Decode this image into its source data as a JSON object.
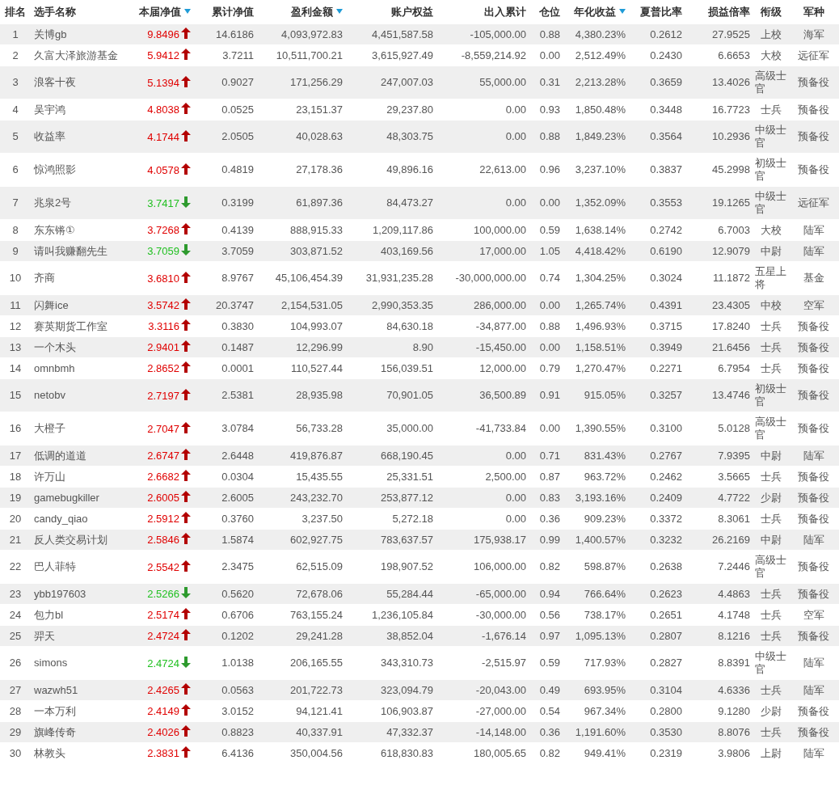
{
  "table": {
    "columns": [
      {
        "label": "排名",
        "sort_indicator": false
      },
      {
        "label": "选手名称",
        "sort_indicator": false
      },
      {
        "label": "本届净值",
        "sort_indicator": true
      },
      {
        "label": "累计净值",
        "sort_indicator": false
      },
      {
        "label": "盈利金额",
        "sort_indicator": true
      },
      {
        "label": "账户权益",
        "sort_indicator": false
      },
      {
        "label": "出入累计",
        "sort_indicator": false
      },
      {
        "label": "仓位",
        "sort_indicator": false
      },
      {
        "label": "年化收益",
        "sort_indicator": true
      },
      {
        "label": "夏普比率",
        "sort_indicator": false
      },
      {
        "label": "损益倍率",
        "sort_indicator": false
      },
      {
        "label": "衔级",
        "sort_indicator": false
      },
      {
        "label": "军种",
        "sort_indicator": false
      }
    ],
    "rows": [
      {
        "rising": true,
        "cells": [
          "1",
          "关博gb",
          "9.8496",
          "14.6186",
          "4,093,972.83",
          "4,451,587.58",
          "-105,000.00",
          "0.88",
          "4,380.23%",
          "0.2612",
          "27.9525",
          "上校",
          "海军"
        ]
      },
      {
        "rising": true,
        "cells": [
          "2",
          "久富大泽旅游基金",
          "5.9412",
          "3.7211",
          "10,511,700.21",
          "3,615,927.49",
          "-8,559,214.92",
          "0.00",
          "2,512.49%",
          "0.2430",
          "6.6653",
          "大校",
          "远征军"
        ]
      },
      {
        "rising": true,
        "cells": [
          "3",
          "浪客十夜",
          "5.1394",
          "0.9027",
          "171,256.29",
          "247,007.03",
          "55,000.00",
          "0.31",
          "2,213.28%",
          "0.3659",
          "13.4026",
          "高级士官",
          "预备役"
        ]
      },
      {
        "rising": true,
        "cells": [
          "4",
          "吴宇鸿",
          "4.8038",
          "0.0525",
          "23,151.37",
          "29,237.80",
          "0.00",
          "0.93",
          "1,850.48%",
          "0.3448",
          "16.7723",
          "士兵",
          "预备役"
        ]
      },
      {
        "rising": true,
        "cells": [
          "5",
          "收益率",
          "4.1744",
          "2.0505",
          "40,028.63",
          "48,303.75",
          "0.00",
          "0.88",
          "1,849.23%",
          "0.3564",
          "10.2936",
          "中级士官",
          "预备役"
        ]
      },
      {
        "rising": true,
        "cells": [
          "6",
          "惊鸿照影",
          "4.0578",
          "0.4819",
          "27,178.36",
          "49,896.16",
          "22,613.00",
          "0.96",
          "3,237.10%",
          "0.3837",
          "45.2998",
          "初级士官",
          "预备役"
        ]
      },
      {
        "rising": false,
        "cells": [
          "7",
          "兆泉2号",
          "3.7417",
          "0.3199",
          "61,897.36",
          "84,473.27",
          "0.00",
          "0.00",
          "1,352.09%",
          "0.3553",
          "19.1265",
          "中级士官",
          "远征军"
        ]
      },
      {
        "rising": true,
        "cells": [
          "8",
          "东东锵①",
          "3.7268",
          "0.4139",
          "888,915.33",
          "1,209,117.86",
          "100,000.00",
          "0.59",
          "1,638.14%",
          "0.2742",
          "6.7003",
          "大校",
          "陆军"
        ]
      },
      {
        "rising": false,
        "cells": [
          "9",
          "请叫我赚翻先生",
          "3.7059",
          "3.7059",
          "303,871.52",
          "403,169.56",
          "17,000.00",
          "1.05",
          "4,418.42%",
          "0.6190",
          "12.9079",
          "中尉",
          "陆军"
        ]
      },
      {
        "rising": true,
        "cells": [
          "10",
          "齐商",
          "3.6810",
          "8.9767",
          "45,106,454.39",
          "31,931,235.28",
          "-30,000,000.00",
          "0.74",
          "1,304.25%",
          "0.3024",
          "11.1872",
          "五星上将",
          "基金"
        ]
      },
      {
        "rising": true,
        "cells": [
          "11",
          "闪舞ice",
          "3.5742",
          "20.3747",
          "2,154,531.05",
          "2,990,353.35",
          "286,000.00",
          "0.00",
          "1,265.74%",
          "0.4391",
          "23.4305",
          "中校",
          "空军"
        ]
      },
      {
        "rising": true,
        "cells": [
          "12",
          "赛英期货工作室",
          "3.3116",
          "0.3830",
          "104,993.07",
          "84,630.18",
          "-34,877.00",
          "0.88",
          "1,496.93%",
          "0.3715",
          "17.8240",
          "士兵",
          "预备役"
        ]
      },
      {
        "rising": true,
        "cells": [
          "13",
          "一个木头",
          "2.9401",
          "0.1487",
          "12,296.99",
          "8.90",
          "-15,450.00",
          "0.00",
          "1,158.51%",
          "0.3949",
          "21.6456",
          "士兵",
          "预备役"
        ]
      },
      {
        "rising": true,
        "cells": [
          "14",
          "omnbmh",
          "2.8652",
          "0.0001",
          "110,527.44",
          "156,039.51",
          "12,000.00",
          "0.79",
          "1,270.47%",
          "0.2271",
          "6.7954",
          "士兵",
          "预备役"
        ]
      },
      {
        "rising": true,
        "cells": [
          "15",
          "netobv",
          "2.7197",
          "2.5381",
          "28,935.98",
          "70,901.05",
          "36,500.89",
          "0.91",
          "915.05%",
          "0.3257",
          "13.4746",
          "初级士官",
          "预备役"
        ]
      },
      {
        "rising": true,
        "cells": [
          "16",
          "大橙子",
          "2.7047",
          "3.0784",
          "56,733.28",
          "35,000.00",
          "-41,733.84",
          "0.00",
          "1,390.55%",
          "0.3100",
          "5.0128",
          "高级士官",
          "预备役"
        ]
      },
      {
        "rising": true,
        "cells": [
          "17",
          "低调的道道",
          "2.6747",
          "2.6448",
          "419,876.87",
          "668,190.45",
          "0.00",
          "0.71",
          "831.43%",
          "0.2767",
          "7.9395",
          "中尉",
          "陆军"
        ]
      },
      {
        "rising": true,
        "cells": [
          "18",
          "许万山",
          "2.6682",
          "0.0304",
          "15,435.55",
          "25,331.51",
          "2,500.00",
          "0.87",
          "963.72%",
          "0.2462",
          "3.5665",
          "士兵",
          "预备役"
        ]
      },
      {
        "rising": true,
        "cells": [
          "19",
          "gamebugkiller",
          "2.6005",
          "2.6005",
          "243,232.70",
          "253,877.12",
          "0.00",
          "0.83",
          "3,193.16%",
          "0.2409",
          "4.7722",
          "少尉",
          "预备役"
        ]
      },
      {
        "rising": true,
        "cells": [
          "20",
          "candy_qiao",
          "2.5912",
          "0.3760",
          "3,237.50",
          "5,272.18",
          "0.00",
          "0.36",
          "909.23%",
          "0.3372",
          "8.3061",
          "士兵",
          "预备役"
        ]
      },
      {
        "rising": true,
        "cells": [
          "21",
          "反人类交易计划",
          "2.5846",
          "1.5874",
          "602,927.75",
          "783,637.57",
          "175,938.17",
          "0.99",
          "1,400.57%",
          "0.3232",
          "26.2169",
          "中尉",
          "陆军"
        ]
      },
      {
        "rising": true,
        "cells": [
          "22",
          "巴人菲特",
          "2.5542",
          "2.3475",
          "62,515.09",
          "198,907.52",
          "106,000.00",
          "0.82",
          "598.87%",
          "0.2638",
          "7.2446",
          "高级士官",
          "预备役"
        ]
      },
      {
        "rising": false,
        "cells": [
          "23",
          "ybb197603",
          "2.5266",
          "0.5620",
          "72,678.06",
          "55,284.44",
          "-65,000.00",
          "0.94",
          "766.64%",
          "0.2623",
          "4.4863",
          "士兵",
          "预备役"
        ]
      },
      {
        "rising": true,
        "cells": [
          "24",
          "包力bl",
          "2.5174",
          "0.6706",
          "763,155.24",
          "1,236,105.84",
          "-30,000.00",
          "0.56",
          "738.17%",
          "0.2651",
          "4.1748",
          "士兵",
          "空军"
        ]
      },
      {
        "rising": true,
        "cells": [
          "25",
          "羿天",
          "2.4724",
          "0.1202",
          "29,241.28",
          "38,852.04",
          "-1,676.14",
          "0.97",
          "1,095.13%",
          "0.2807",
          "8.1216",
          "士兵",
          "预备役"
        ]
      },
      {
        "rising": false,
        "cells": [
          "26",
          "simons",
          "2.4724",
          "1.0138",
          "206,165.55",
          "343,310.73",
          "-2,515.97",
          "0.59",
          "717.93%",
          "0.2827",
          "8.8391",
          "中级士官",
          "陆军"
        ]
      },
      {
        "rising": true,
        "cells": [
          "27",
          "wazwh51",
          "2.4265",
          "0.0563",
          "201,722.73",
          "323,094.79",
          "-20,043.00",
          "0.49",
          "693.95%",
          "0.3104",
          "4.6336",
          "士兵",
          "陆军"
        ]
      },
      {
        "rising": true,
        "cells": [
          "28",
          "一本万利",
          "2.4149",
          "3.0152",
          "94,121.41",
          "106,903.87",
          "-27,000.00",
          "0.54",
          "967.34%",
          "0.2800",
          "9.1280",
          "少尉",
          "预备役"
        ]
      },
      {
        "rising": true,
        "cells": [
          "29",
          "旗峰传奇",
          "2.4026",
          "0.8823",
          "40,337.91",
          "47,332.37",
          "-14,148.00",
          "0.36",
          "1,191.60%",
          "0.3530",
          "8.8076",
          "士兵",
          "预备役"
        ]
      },
      {
        "rising": true,
        "cells": [
          "30",
          "林教头",
          "2.3831",
          "6.4136",
          "350,004.56",
          "618,830.83",
          "180,005.65",
          "0.82",
          "949.41%",
          "0.2319",
          "3.9806",
          "上尉",
          "陆军"
        ]
      }
    ]
  }
}
